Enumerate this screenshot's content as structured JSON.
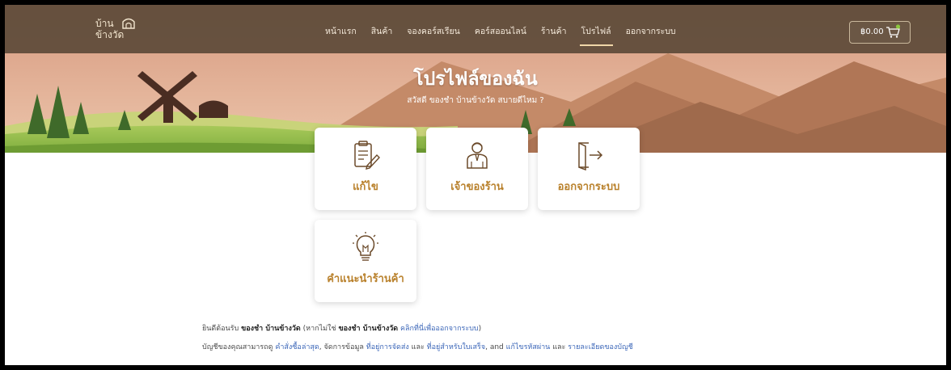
{
  "logo": {
    "line1": "บ้าน",
    "line2": "ข้างวัด"
  },
  "nav": {
    "items": [
      {
        "label": "หน้าแรก",
        "active": false
      },
      {
        "label": "สินค้า",
        "active": false
      },
      {
        "label": "จองคอร์สเรียน",
        "active": false
      },
      {
        "label": "คอร์สออนไลน์",
        "active": false
      },
      {
        "label": "ร้านค้า",
        "active": false
      },
      {
        "label": "โปรไฟล์",
        "active": true
      },
      {
        "label": "ออกจากระบบ",
        "active": false
      }
    ],
    "cart_amount": "฿0.00"
  },
  "hero": {
    "title": "โปรไฟล์ของฉัน",
    "subtitle": "สวัสดี ของชำ บ้านข้างวัด สบายดีไหม ?"
  },
  "cards": [
    {
      "label": "แก้ไข",
      "icon": "edit-document-icon"
    },
    {
      "label": "เจ้าของร้าน",
      "icon": "shop-owner-icon"
    },
    {
      "label": "ออกจากระบบ",
      "icon": "logout-icon"
    },
    {
      "label": "คำแนะนำร้านค้า",
      "icon": "lightbulb-icon"
    }
  ],
  "welcome": {
    "prefix": "ยินดีต้อนรับ",
    "user": "ของชำ บ้านข้างวัด",
    "not_prefix": "(หากไม่ใช่",
    "user2": "ของชำ บ้านข้างวัด",
    "logout_link": "คลิกที่นี่เพื่อออกจากระบบ",
    "suffix": ")"
  },
  "account": {
    "prefix": "บัญชีของคุณสามารถดู",
    "link1": "คำสั่งซื้อล่าสุด",
    "mid1": ", จัดการข้อมูล",
    "link2": "ที่อยู่การจัดส่ง",
    "and1": "และ",
    "link3": "ที่อยู่สำหรับใบเสร็จ",
    "mid2": ", and",
    "link4": "แก้ไขรหัสผ่าน",
    "and2": "และ",
    "link5": "รายละเอียดของบัญชี"
  },
  "colors": {
    "accent": "#b9812c",
    "link": "#3b66b8",
    "nav_bg": "#5c4a38",
    "hero_sky": "#e7b49a"
  }
}
